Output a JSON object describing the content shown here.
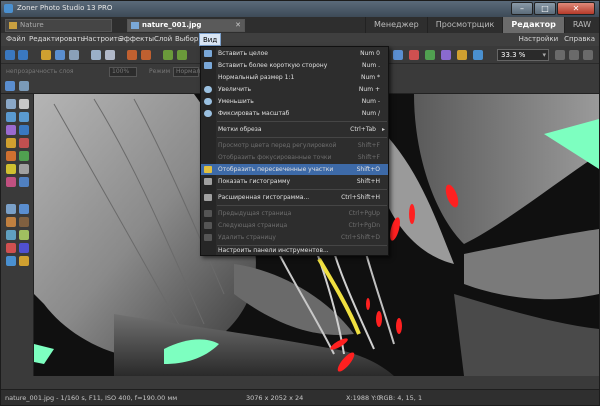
{
  "window": {
    "title": "Zoner Photo Studio 13 PRO",
    "minimize": "–",
    "maximize": "□",
    "close": "✕"
  },
  "tabs": [
    {
      "label": "Nature",
      "active": false
    },
    {
      "label": "nature_001.jpg",
      "active": true
    }
  ],
  "tab_close": "✕",
  "modes": [
    "Менеджер",
    "Просмотрщик",
    "Редактор",
    "RAW"
  ],
  "active_mode": "Редактор",
  "menu": [
    "Файл",
    "Редактировать",
    "Настроить",
    "Эффекты",
    "Слой",
    "Выбор",
    "Вид"
  ],
  "menu_right": {
    "settings": "Настройки",
    "help": "Справка"
  },
  "zoom": "33.3 %",
  "options": {
    "transparency_label": "непрозрачность слоя",
    "transparency_value": "100%",
    "mode_label": "Режим",
    "mode_value": "Нормально"
  },
  "view_menu": {
    "items": [
      {
        "label": "Вставить целое",
        "shortcut": "Num 0",
        "disabled": false
      },
      {
        "label": "Вставить более короткую сторону",
        "shortcut": "Num .",
        "disabled": false
      },
      {
        "label": "Нормальный размер 1:1",
        "shortcut": "Num *",
        "disabled": false
      },
      {
        "label": "Увеличить",
        "shortcut": "Num +",
        "disabled": false
      },
      {
        "label": "Уменьшить",
        "shortcut": "Num -",
        "disabled": false
      },
      {
        "label": "Фиксировать масштаб",
        "shortcut": "Num /",
        "disabled": false
      },
      {
        "label": "Метки обреза",
        "shortcut": "Ctrl+Tab",
        "disabled": false,
        "submenu": true
      },
      {
        "label": "Просмотр цвета перед регулировкой",
        "shortcut": "Shift+F",
        "disabled": true
      },
      {
        "label": "Отобразить фокусированные точки",
        "shortcut": "Shift+F",
        "disabled": true
      },
      {
        "label": "Отобразить пересвеченные участки",
        "shortcut": "Shift+O",
        "disabled": false,
        "highlighted": true
      },
      {
        "label": "Показать гистограмму",
        "shortcut": "Shift+H",
        "disabled": false
      },
      {
        "label": "Расширенная гистограмма...",
        "shortcut": "Ctrl+Shift+H",
        "disabled": false
      },
      {
        "label": "Предыдущая страница",
        "shortcut": "Ctrl+PgUp",
        "disabled": true
      },
      {
        "label": "Следующая страница",
        "shortcut": "Ctrl+PgDn",
        "disabled": true
      },
      {
        "label": "Удалить страницу",
        "shortcut": "Ctrl+Shift+D",
        "disabled": true
      },
      {
        "label": "Настроить панели инструментов...",
        "shortcut": "",
        "disabled": false
      }
    ]
  },
  "status": {
    "file_info": "nature_001.jpg - 1/160 s, F11, ISO 400, f=190.00 мм",
    "dimensions": "3076 x 2052 x 24",
    "coords": "X:1988 Y:0",
    "rgb": "RGB: 4, 15, 1"
  },
  "colors": {
    "highlight": "#3d6aa8",
    "overexposed": "#ff2020",
    "underexposed": "#7dffc0",
    "brand": "#4a90d0"
  }
}
